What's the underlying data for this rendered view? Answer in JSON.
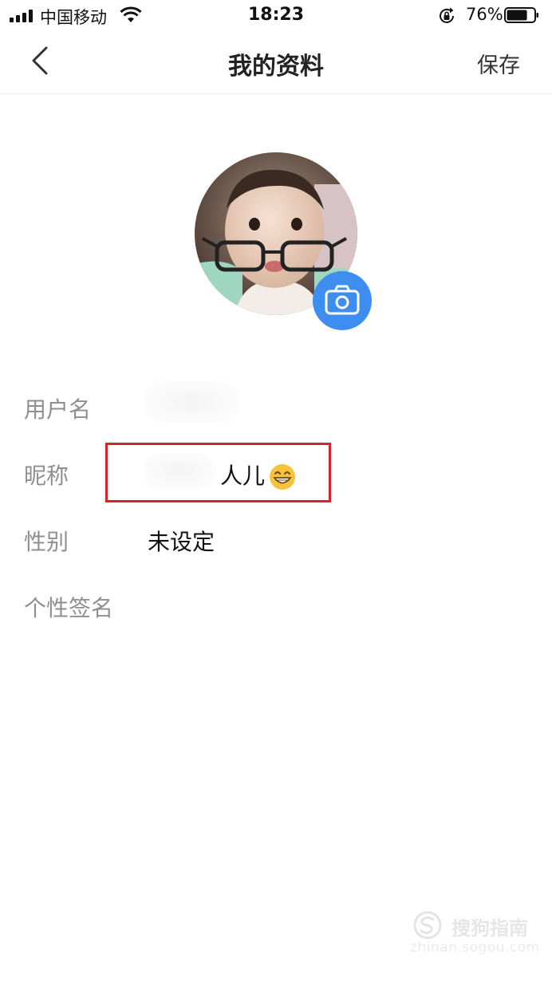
{
  "status_bar": {
    "carrier": "中国移动",
    "time": "18:23",
    "battery_percent": "76%",
    "battery_level": 0.76,
    "icons": [
      "signal-icon",
      "wifi-icon",
      "rotation-lock-icon",
      "battery-icon"
    ]
  },
  "nav": {
    "back_icon": "chevron-left-icon",
    "title": "我的资料",
    "save_label": "保存"
  },
  "avatar": {
    "camera_icon": "camera-icon",
    "camera_color": "#3d8ef0"
  },
  "profile": {
    "username_label": "用户名",
    "username_value": "",
    "nickname_label": "昵称",
    "nickname_value": "人儿",
    "nickname_emoji": "grinning-face-icon",
    "gender_label": "性别",
    "gender_value": "未设定",
    "signature_label": "个性签名",
    "signature_value": ""
  },
  "annotation": {
    "highlight_color": "#d9232b"
  },
  "watermark": {
    "brand": "搜狗指南",
    "url": "zhinan.sogou.com"
  }
}
